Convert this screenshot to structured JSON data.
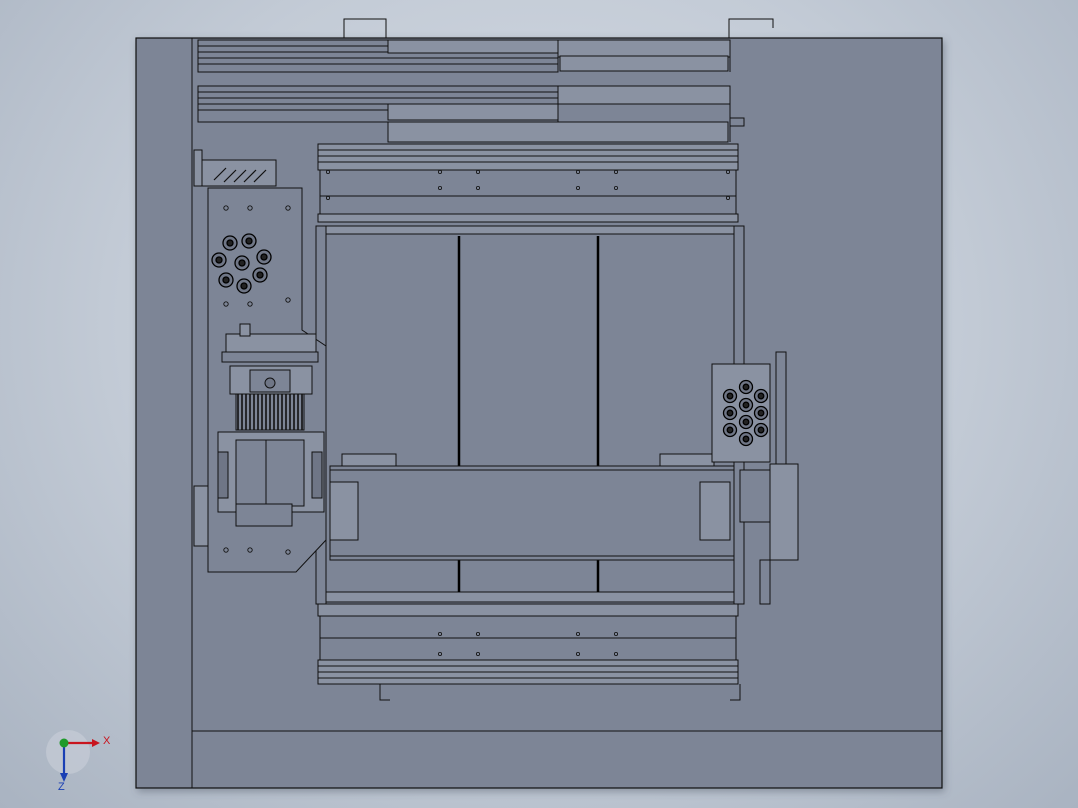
{
  "app": {
    "view_type": "cad-drawing-viewport",
    "background_colors": {
      "center": "#d7dde6",
      "edge": "#a9b3c1"
    }
  },
  "model": {
    "face_color": "#7d8596",
    "edge_color": "#000000",
    "frame_color": "#6f7686"
  },
  "triad": {
    "x_label": "X",
    "z_label": "Z",
    "x_color": "#c8141e",
    "y_color": "#1f9a2a",
    "z_color": "#1a3fb4"
  }
}
